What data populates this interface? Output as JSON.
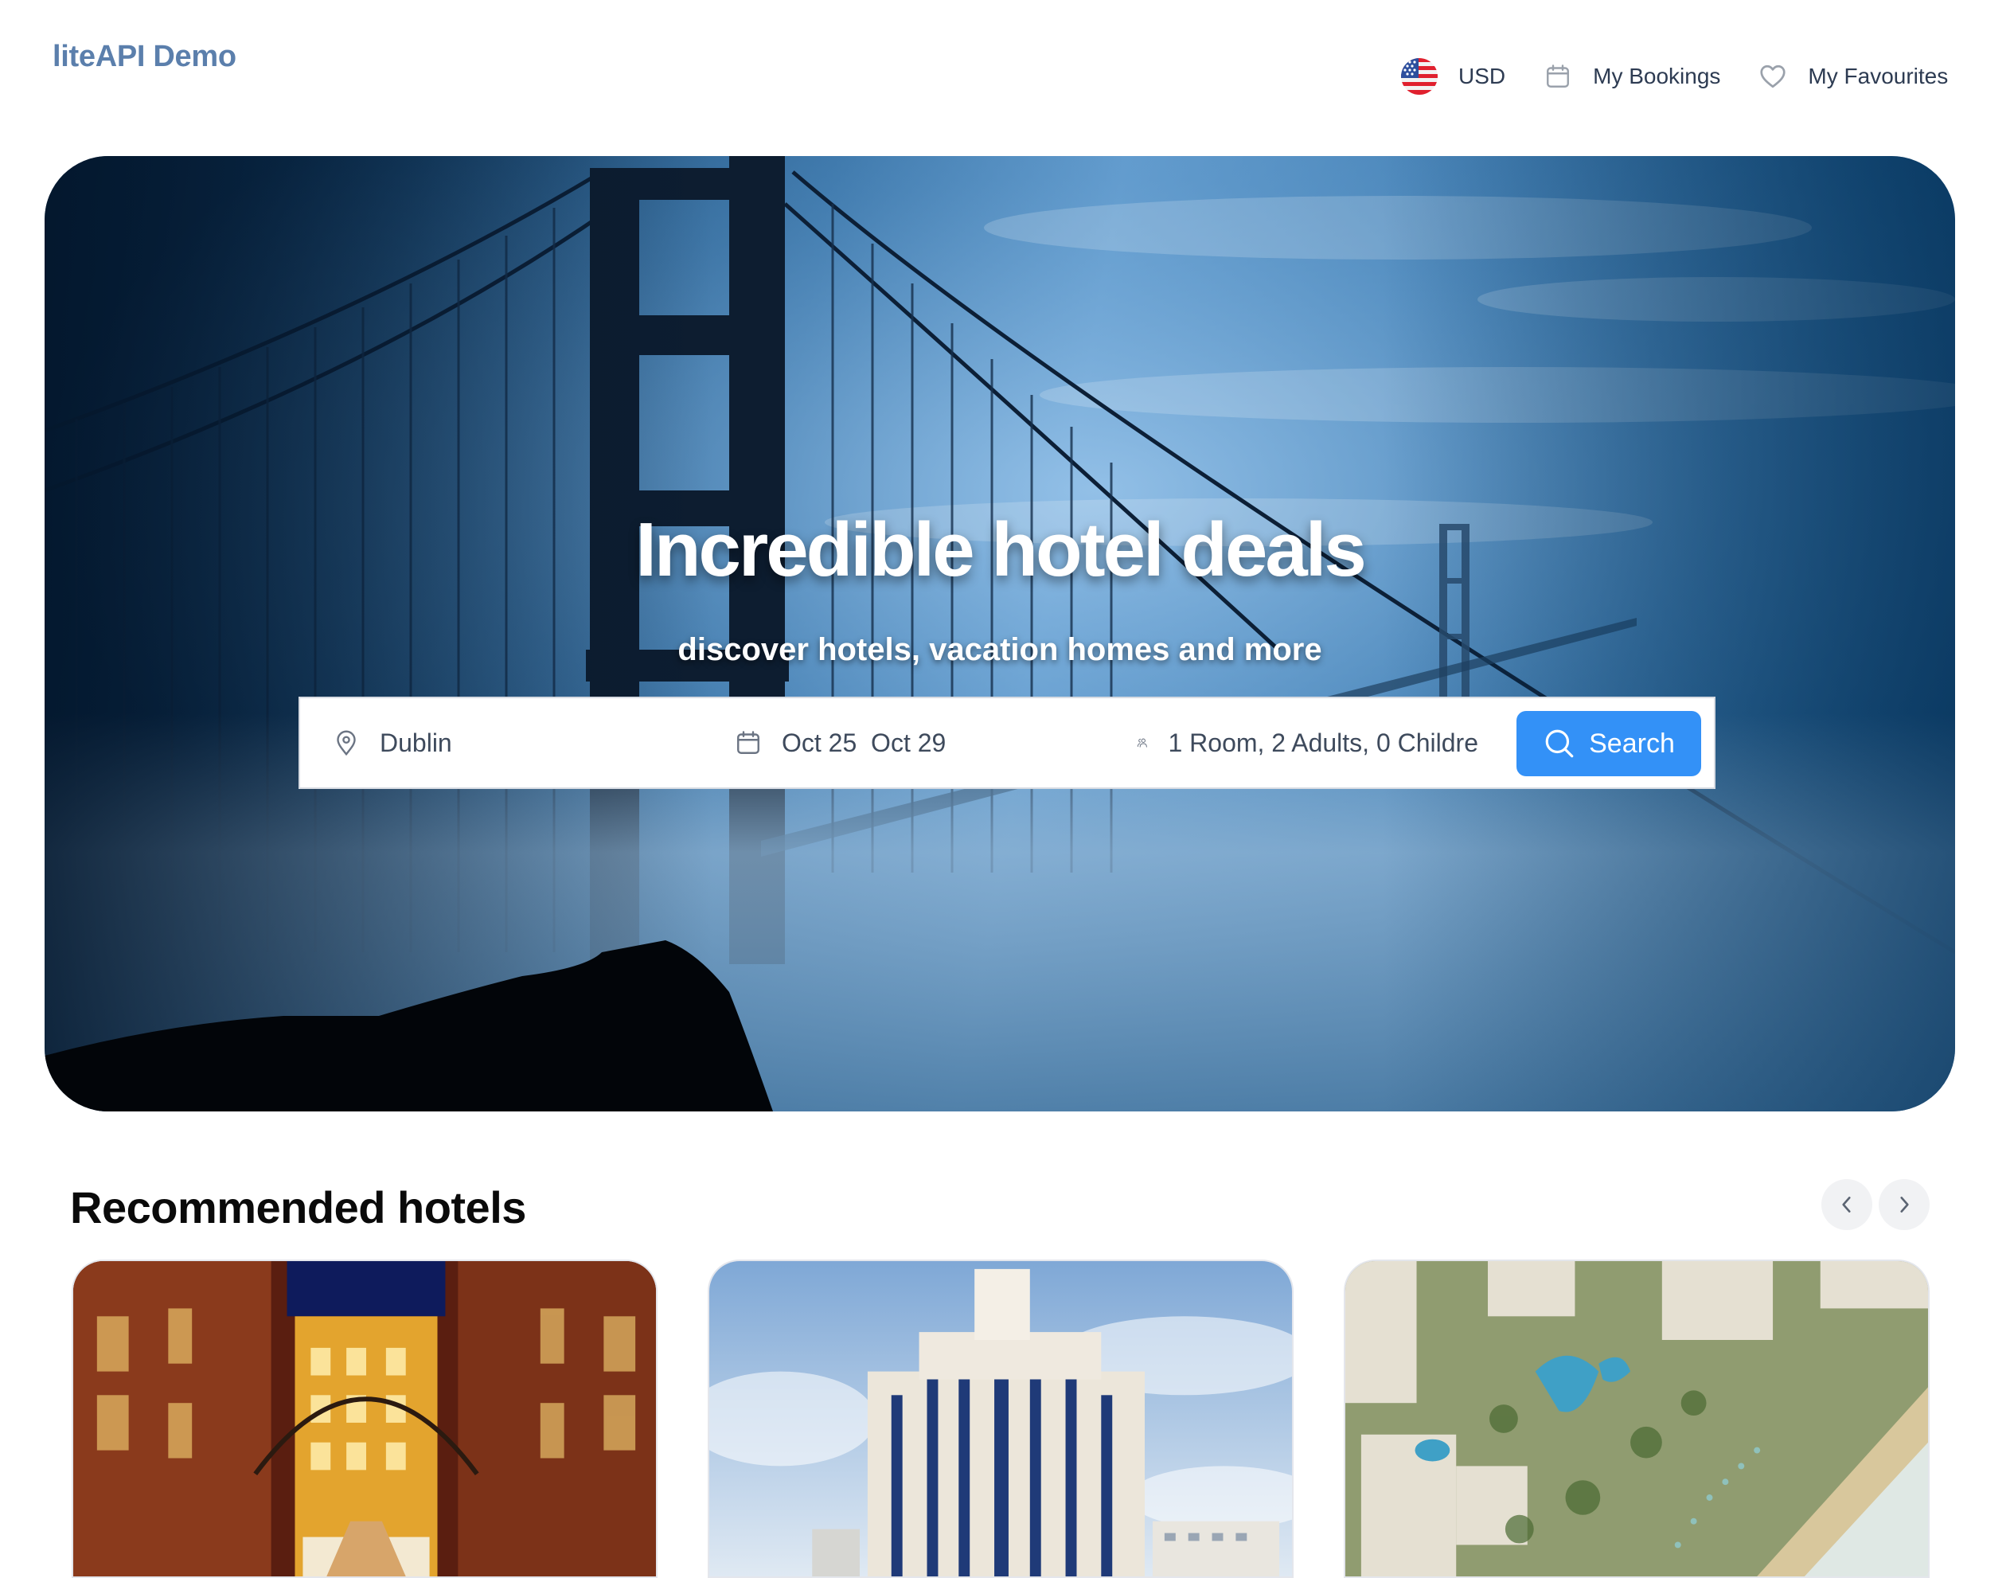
{
  "header": {
    "logo": "liteAPI Demo",
    "currency": {
      "label": "USD",
      "icon": "us-flag-icon"
    },
    "bookings": {
      "label": "My Bookings",
      "icon": "calendar-icon"
    },
    "favourites": {
      "label": "My Favourites",
      "icon": "heart-icon"
    }
  },
  "hero": {
    "title": "Incredible hotel deals",
    "subtitle": "discover hotels, vacation homes and more"
  },
  "search": {
    "destination": {
      "value": "Dublin",
      "icon": "map-pin-icon"
    },
    "dates": {
      "value": "Oct 25  Oct 29",
      "icon": "calendar-icon"
    },
    "guests": {
      "value": "1 Room, 2 Adults, 0 Childre",
      "icon": "users-icon"
    },
    "button": {
      "label": "Search",
      "icon": "search-icon"
    }
  },
  "recommended": {
    "title": "Recommended hotels",
    "prev_icon": "chevron-left-icon",
    "next_icon": "chevron-right-icon",
    "cards": [
      {
        "image": "night-lit red brick hotel courtyard"
      },
      {
        "image": "white high-rise hotel tower under blue sky"
      },
      {
        "image": "aerial beach resort with pools"
      }
    ]
  },
  "colors": {
    "brand": "#5b7fac",
    "primary_button": "#3391f7",
    "text": "#2d3b52",
    "icon_gray": "#9aa1ab"
  }
}
